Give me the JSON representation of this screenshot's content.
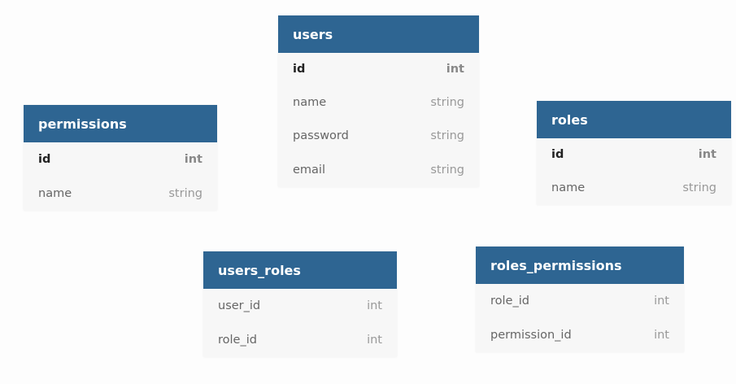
{
  "tables": [
    {
      "name": "users",
      "columns": [
        {
          "name": "id",
          "type": "int",
          "primary": true
        },
        {
          "name": "name",
          "type": "string",
          "primary": false
        },
        {
          "name": "password",
          "type": "string",
          "primary": false
        },
        {
          "name": "email",
          "type": "string",
          "primary": false
        }
      ]
    },
    {
      "name": "permissions",
      "columns": [
        {
          "name": "id",
          "type": "int",
          "primary": true
        },
        {
          "name": "name",
          "type": "string",
          "primary": false
        }
      ]
    },
    {
      "name": "roles",
      "columns": [
        {
          "name": "id",
          "type": "int",
          "primary": true
        },
        {
          "name": "name",
          "type": "string",
          "primary": false
        }
      ]
    },
    {
      "name": "users_roles",
      "columns": [
        {
          "name": "user_id",
          "type": "int",
          "primary": false
        },
        {
          "name": "role_id",
          "type": "int",
          "primary": false
        }
      ]
    },
    {
      "name": "roles_permissions",
      "columns": [
        {
          "name": "role_id",
          "type": "int",
          "primary": false
        },
        {
          "name": "permission_id",
          "type": "int",
          "primary": false
        }
      ]
    }
  ],
  "colors": {
    "header_bg": "#2e6592",
    "header_text": "#ffffff",
    "body_bg": "#f7f7f7",
    "page_bg": "#fdfdfd"
  }
}
